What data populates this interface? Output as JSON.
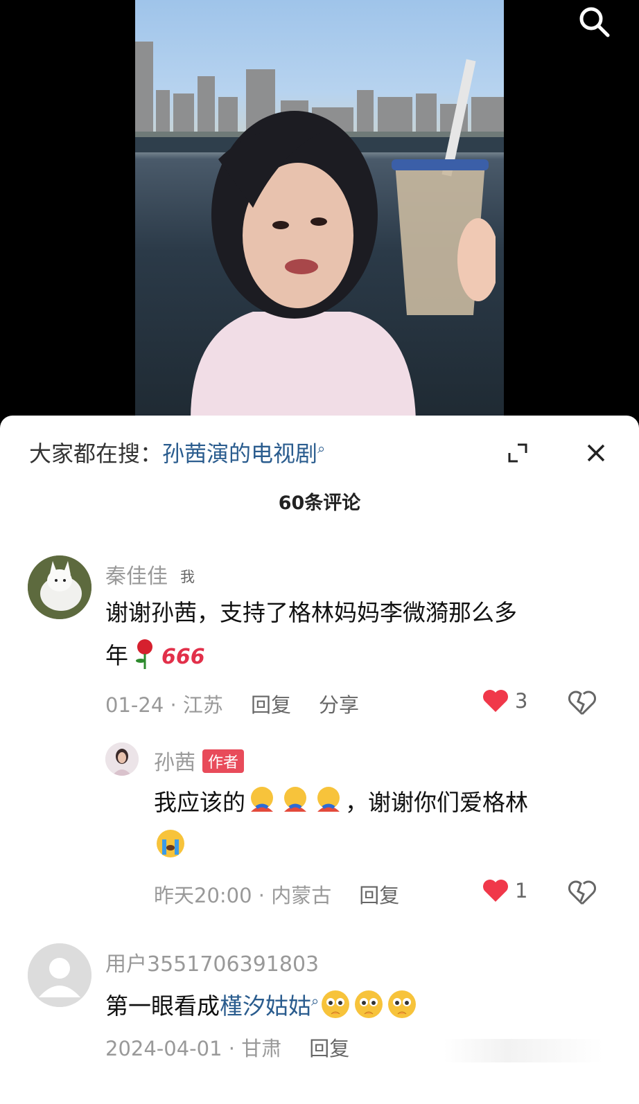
{
  "hot_search": {
    "prefix": "大家都在搜：",
    "query": "孙茜演的电视剧"
  },
  "comment_count": "60条评论",
  "comments": [
    {
      "user": "秦佳佳",
      "tag": "我",
      "text": "谢谢孙茜，支持了格林妈妈李微漪那么多",
      "text_line2": "年",
      "sticker": "666",
      "date_loc": "01-24 · 江苏",
      "reply": "回复",
      "share": "分享",
      "likes": "3"
    },
    {
      "user": "孙茜",
      "tag": "作者",
      "text_before": "我应该的",
      "text_after": "，谢谢你们爱格林",
      "date_loc": "昨天20:00 · 内蒙古",
      "reply": "回复",
      "likes": "1"
    },
    {
      "user": "用户3551706391803",
      "text_before": "第一眼看成",
      "link": "槿汐姑姑",
      "date_loc": "2024-04-01 · 甘肃",
      "reply": "回复"
    }
  ],
  "colors": {
    "like_red": "#f0384a",
    "link_blue": "#2a5c8e",
    "author_tag": "#e84b5a"
  },
  "icons": [
    "search-icon",
    "expand-icon",
    "close-icon",
    "heart-icon",
    "broken-heart-icon",
    "rose-icon",
    "hug-emoji",
    "crying-emoji",
    "pleading-emoji"
  ]
}
